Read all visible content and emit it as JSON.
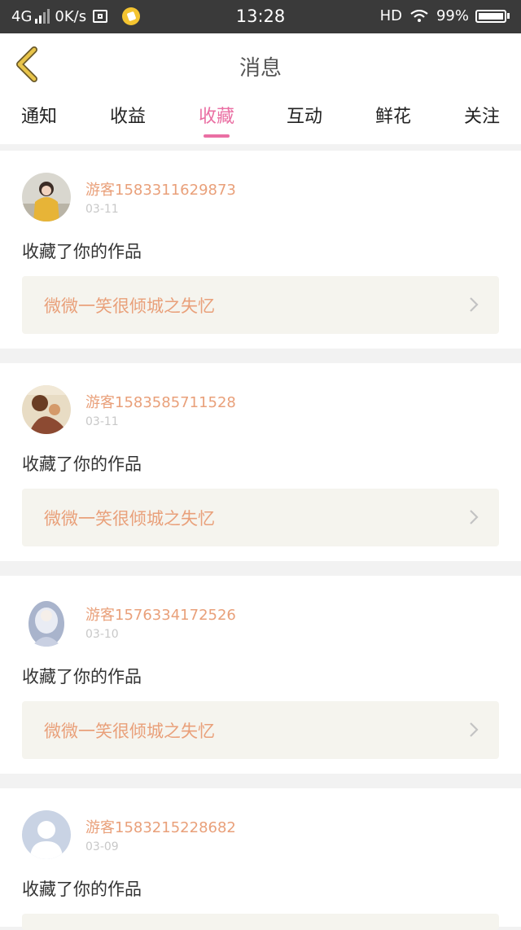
{
  "status_bar": {
    "network": "4G",
    "speed": "0K/s",
    "time": "13:28",
    "hd": "HD",
    "battery": "99%"
  },
  "header": {
    "title": "消息"
  },
  "tabs": [
    {
      "label": "通知"
    },
    {
      "label": "收益"
    },
    {
      "label": "收藏",
      "active": true
    },
    {
      "label": "互动"
    },
    {
      "label": "鲜花"
    },
    {
      "label": "关注"
    }
  ],
  "messages": [
    {
      "user": "游客1583311629873",
      "date": "03-11",
      "action": "收藏了你的作品",
      "work": "微微一笑很倾城之失忆",
      "avatar": "avatar-photo"
    },
    {
      "user": "游客1583585711528",
      "date": "03-11",
      "action": "收藏了你的作品",
      "work": "微微一笑很倾城之失忆",
      "avatar": "avatar-photo"
    },
    {
      "user": "游客1576334172526",
      "date": "03-10",
      "action": "收藏了你的作品",
      "work": "微微一笑很倾城之失忆",
      "avatar": "avatar-anime"
    },
    {
      "user": "游客1583215228682",
      "date": "03-09",
      "action": "收藏了你的作品",
      "work": "",
      "avatar": "default-avatar"
    }
  ],
  "colors": {
    "accent": "#ea6fa3",
    "username": "#e9a07a",
    "work_bg": "#f5f4ee",
    "back_arrow": "#e8c44a"
  }
}
